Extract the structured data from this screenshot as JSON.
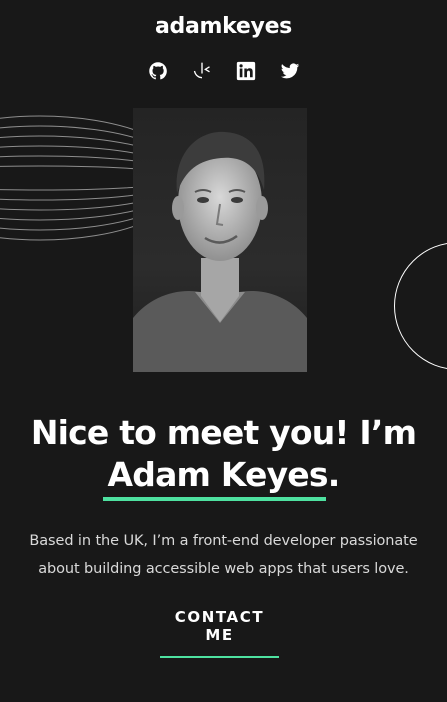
{
  "header": {
    "brand": "adamkeyes",
    "socials": [
      {
        "name": "github",
        "icon": "github-icon"
      },
      {
        "name": "frontend-mentor",
        "icon": "frontend-mentor-icon"
      },
      {
        "name": "linkedin",
        "icon": "linkedin-icon"
      },
      {
        "name": "twitter",
        "icon": "twitter-icon"
      }
    ]
  },
  "hero": {
    "greeting": "Nice to meet you! I’m",
    "name": "Adam Keyes.",
    "intro_line1": "Based in the UK, I’m a front-end developer passionate",
    "intro_line2": "about building accessible web apps that users love.",
    "contact_label": "CONTACT ME"
  },
  "colors": {
    "background": "#181818",
    "accent": "#4ee1a0",
    "text": "#ffffff"
  }
}
